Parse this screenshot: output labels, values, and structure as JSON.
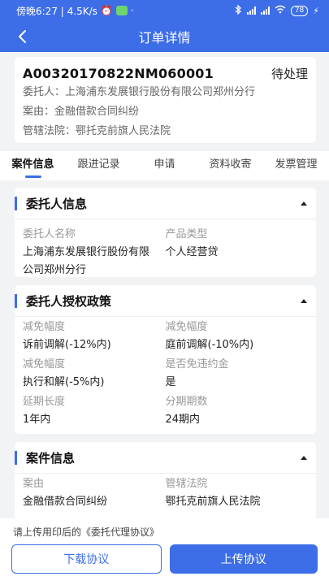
{
  "status_bar": {
    "time_speed": "傍晚6:27 | 4.5K/s",
    "battery": "78"
  },
  "header": {
    "title": "订单详情"
  },
  "order": {
    "number": "A00320170822NM060001",
    "status": "待处理",
    "client": "委托人：上海浦东发展银行股份有限公司郑州分行",
    "cause": "案由：金融借款合同纠纷",
    "court": "管辖法院：鄂托克前旗人民法院"
  },
  "tabs": [
    {
      "label": "案件信息"
    },
    {
      "label": "跟进记录"
    },
    {
      "label": "申请"
    },
    {
      "label": "资料收寄"
    },
    {
      "label": "发票管理"
    }
  ],
  "sections": {
    "client_info": {
      "title": "委托人信息",
      "fields": [
        {
          "label": "委托人名称",
          "value": "上海浦东发展银行股份有限公司郑州分行"
        },
        {
          "label": "产品类型",
          "value": "个人经营贷"
        }
      ]
    },
    "policy": {
      "title": "委托人授权政策",
      "fields": [
        {
          "label": "减免幅度",
          "value": "诉前调解(-12%内)"
        },
        {
          "label": "减免幅度",
          "value": "庭前调解(-10%内)"
        },
        {
          "label": "减免幅度",
          "value": "执行和解(-5%内)"
        },
        {
          "label": "是否免违约金",
          "value": "是"
        },
        {
          "label": "延期长度",
          "value": "1年内"
        },
        {
          "label": "分期期数",
          "value": "24期内"
        }
      ]
    },
    "case_info": {
      "title": "案件信息",
      "fields": [
        {
          "label": "案由",
          "value": "金融借款合同纠纷"
        },
        {
          "label": "管辖法院",
          "value": "鄂托克前旗人民法院"
        }
      ]
    }
  },
  "bottom": {
    "tip": "请上传用印后的《委托代理协议》",
    "download_label": "下载协议",
    "upload_label": "上传协议"
  },
  "colors": {
    "primary": "#3d6ee8",
    "background": "#f2f3f5"
  }
}
